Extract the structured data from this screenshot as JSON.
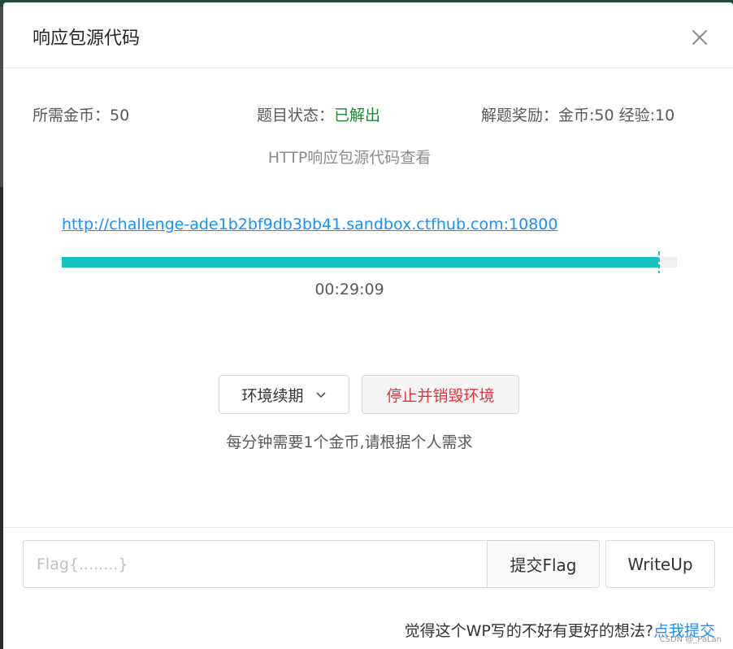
{
  "modal": {
    "title": "响应包源代码"
  },
  "info": {
    "coins_label": "所需金币：",
    "coins_value": "50",
    "status_label": "题目状态：",
    "status_value": "已解出",
    "reward_label": "解题奖励：",
    "reward_value": "金币:50 经验:10"
  },
  "challenge": {
    "subtitle": "HTTP响应包源代码查看",
    "url": "http://challenge-ade1b2bf9db3bb41.sandbox.ctfhub.com:10800",
    "remaining_fraction": 0.97,
    "timer": "00:29:09"
  },
  "actions": {
    "renew_label": "环境续期",
    "stop_label": "停止并销毁环境",
    "note": "每分钟需要1个金币,请根据个人需求"
  },
  "flag": {
    "placeholder": "Flag{........}",
    "value": "",
    "submit_label": "提交Flag",
    "writeup_label": "WriteUp"
  },
  "feedback": {
    "question": "觉得这个WP写的不好有更好的想法?",
    "link": "点我提交"
  },
  "watermark": "CSDN @_PaLan",
  "colors": {
    "progress": "#17c2c2",
    "status_solved": "#1a8a2e",
    "danger": "#e8313c",
    "link": "#1890ff"
  },
  "icons": {
    "close": "close-icon",
    "renew_dropdown": "chevron-down-icon"
  }
}
